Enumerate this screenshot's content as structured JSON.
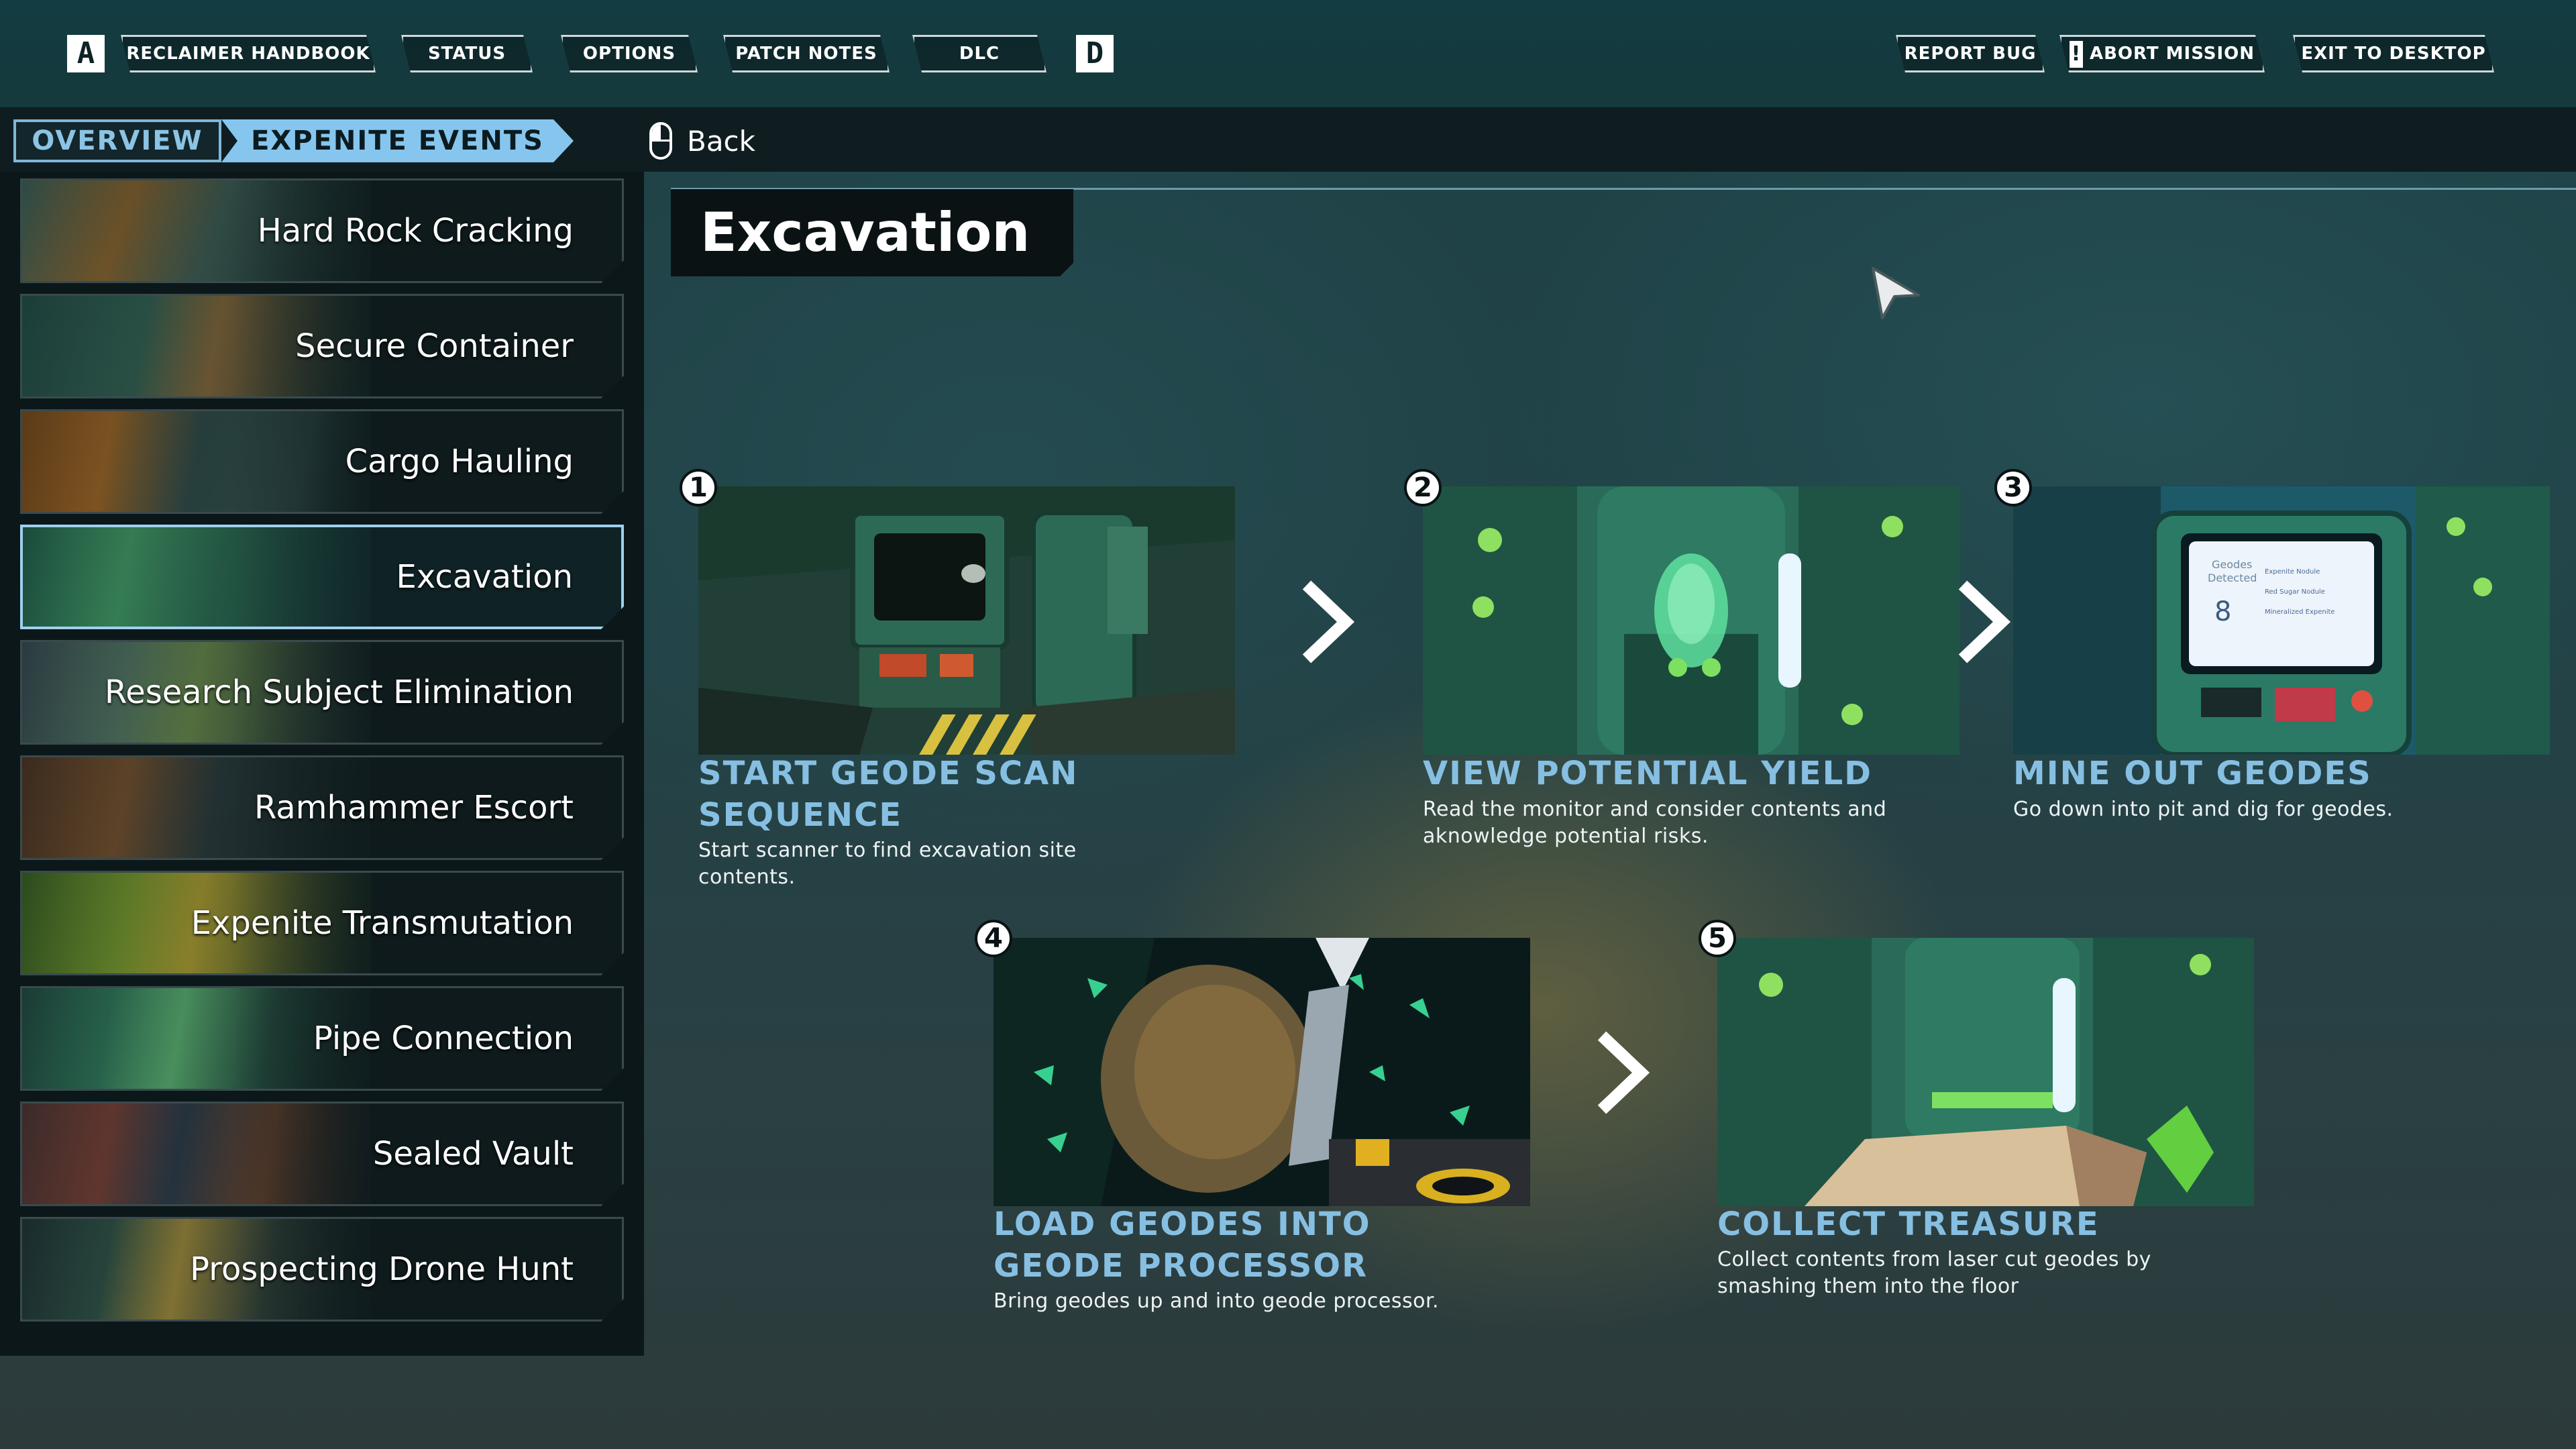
{
  "topbar": {
    "key_left": "A",
    "key_right": "D",
    "tabs": [
      "RECLAIMER HANDBOOK",
      "STATUS",
      "OPTIONS",
      "PATCH NOTES",
      "DLC"
    ],
    "report_bug": "REPORT BUG",
    "abort_mark": "!",
    "abort_mission": "ABORT MISSION",
    "exit": "EXIT TO DESKTOP"
  },
  "breadcrumb": {
    "overview": "OVERVIEW",
    "current": "EXPENITE EVENTS",
    "back": "Back"
  },
  "sidebar": {
    "items": [
      {
        "label": "Hard Rock Cracking"
      },
      {
        "label": "Secure Container"
      },
      {
        "label": "Cargo Hauling"
      },
      {
        "label": "Excavation"
      },
      {
        "label": "Research Subject Elimination"
      },
      {
        "label": "Ramhammer Escort"
      },
      {
        "label": "Expenite Transmutation"
      },
      {
        "label": "Pipe Connection"
      },
      {
        "label": "Sealed Vault"
      },
      {
        "label": "Prospecting Drone Hunt"
      }
    ],
    "selected": "Excavation"
  },
  "content": {
    "title": "Excavation",
    "steps": [
      {
        "num": "1",
        "title": "START GEODE SCAN SEQUENCE",
        "desc": "Start scanner to find excavation site contents."
      },
      {
        "num": "2",
        "title": "VIEW POTENTIAL YIELD",
        "desc": "Read the monitor and consider contents and aknowledge potential risks."
      },
      {
        "num": "3",
        "title": "MINE OUT GEODES",
        "desc": "Go down into pit and dig for geodes."
      },
      {
        "num": "4",
        "title": "LOAD GEODES INTO GEODE PROCESSOR",
        "desc": "Bring geodes up and into geode processor."
      },
      {
        "num": "5",
        "title": "COLLECT TREASURE",
        "desc": "Collect contents from laser cut geodes by smashing them into the floor"
      }
    ],
    "monitor": {
      "label": "Geodes Detected",
      "count": "8",
      "rows": [
        "Expenite Nodule",
        "Red Sugar Nodule",
        "Mineralized Expenite"
      ]
    }
  },
  "colors": {
    "accent": "#86c6ee",
    "step_title": "#86bfe2",
    "sidebar_bg": "#0c1719",
    "topbar_bg": "#123c41"
  }
}
